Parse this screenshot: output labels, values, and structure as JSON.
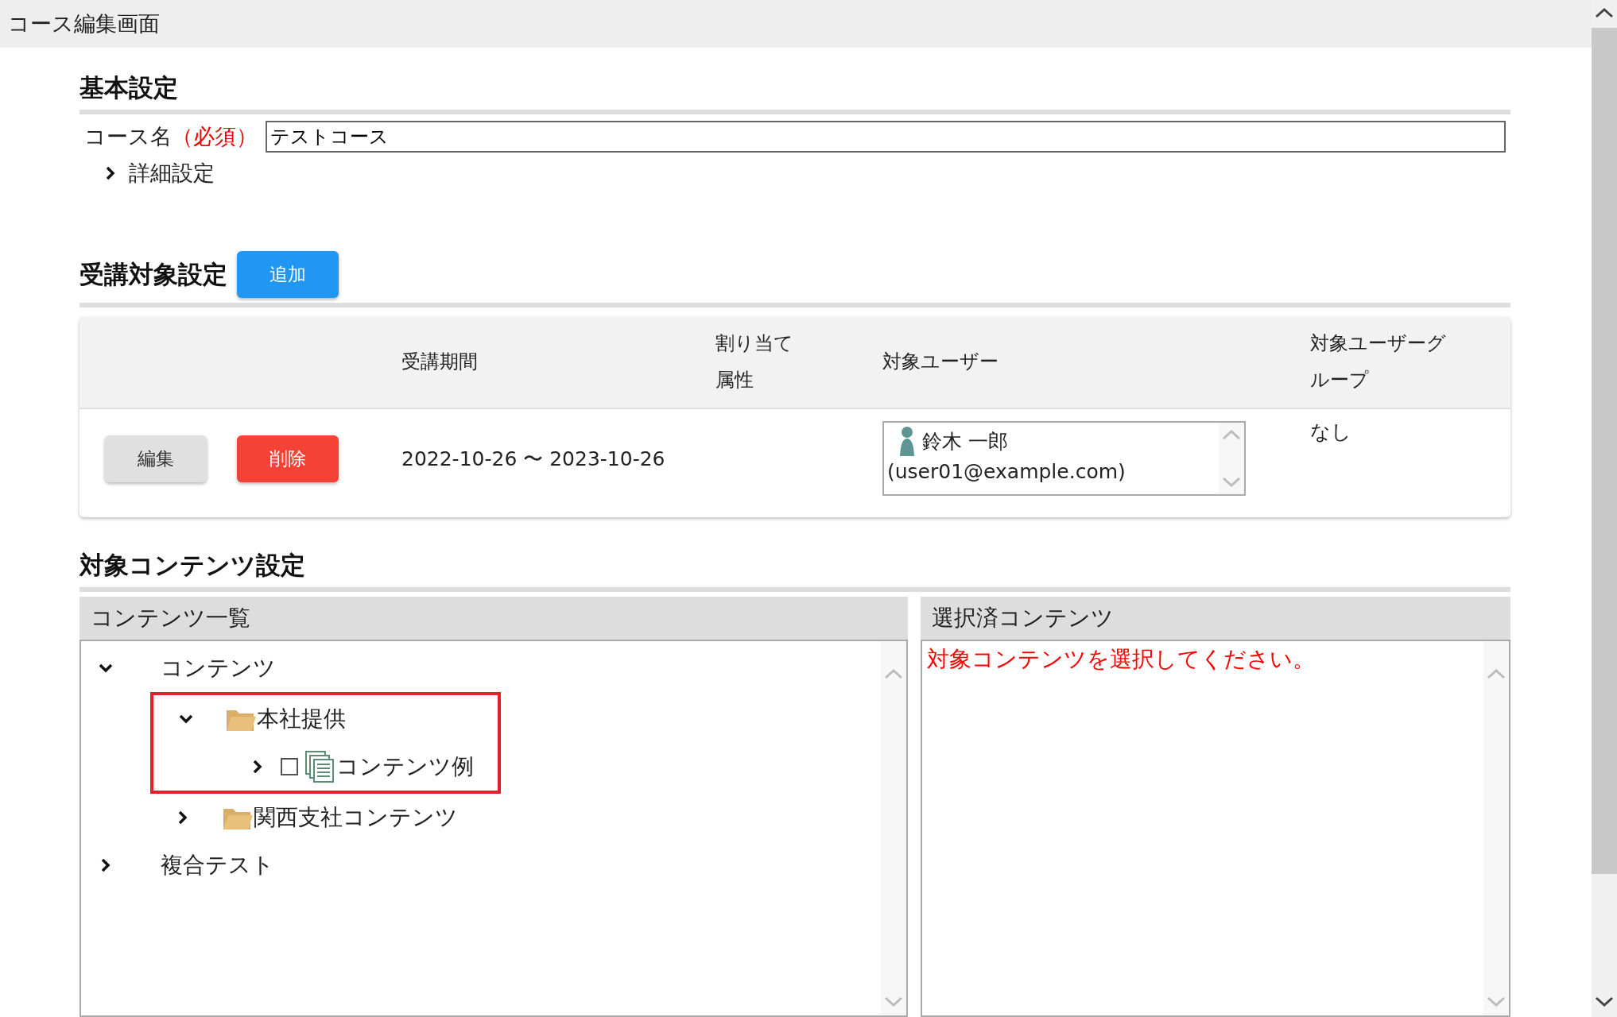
{
  "window": {
    "title": "コース編集画面"
  },
  "basic": {
    "heading": "基本設定",
    "course_label": "コース名",
    "required_mark": "（必須）",
    "course_value": "テストコース",
    "details": {
      "label": "詳細設定",
      "expanded": false
    }
  },
  "target": {
    "heading": "受講対象設定",
    "add_button": "追加",
    "columns": [
      "受講期間",
      "割り当て属性",
      "対象ユーザー",
      "対象ユーザーグループ"
    ],
    "rows": [
      {
        "edit_button": "編集",
        "delete_button": "削除",
        "period": "2022-10-26 〜 2023-10-26",
        "users": [
          {
            "name": "鈴木 一郎",
            "email": "(user01@example.com)"
          }
        ],
        "group": "なし"
      }
    ]
  },
  "contents": {
    "heading": "対象コンテンツ設定",
    "list_panel": {
      "title": "コンテンツ一覧",
      "tree": [
        {
          "kind": "root",
          "label": "コンテンツ",
          "expanded": true,
          "children": [
            {
              "kind": "folder",
              "label": "本社提供",
              "expanded": true,
              "highlighted": true,
              "children": [
                {
                  "kind": "content",
                  "label": "コンテンツ例",
                  "expanded": false,
                  "checked": false
                }
              ]
            },
            {
              "kind": "folder",
              "label": "関西支社コンテンツ",
              "expanded": false,
              "highlighted": false
            }
          ]
        },
        {
          "kind": "root",
          "label": "複合テスト",
          "expanded": false
        }
      ]
    },
    "selected_panel": {
      "title": "選択済コンテンツ",
      "message": "対象コンテンツを選択してください。"
    }
  }
}
